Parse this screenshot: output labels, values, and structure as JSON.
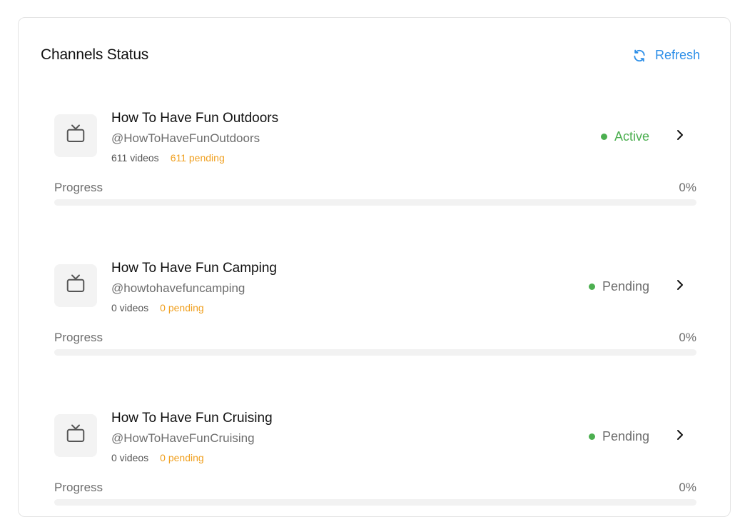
{
  "header": {
    "title": "Channels Status",
    "refresh_label": "Refresh"
  },
  "colors": {
    "accent": "#2d8fe8",
    "active": "#4caf50",
    "pending_text": "#f0a020"
  },
  "channels": [
    {
      "name": "How To Have Fun Outdoors",
      "handle": "@HowToHaveFunOutdoors",
      "videos": "611 videos",
      "pending": "611 pending",
      "status": "Active",
      "progress_label": "Progress",
      "progress_text": "0%",
      "progress_value": 0
    },
    {
      "name": "How To Have Fun Camping",
      "handle": "@howtohavefuncamping",
      "videos": "0 videos",
      "pending": "0 pending",
      "status": "Pending",
      "progress_label": "Progress",
      "progress_text": "0%",
      "progress_value": 0
    },
    {
      "name": "How To Have Fun Cruising",
      "handle": "@HowToHaveFunCruising",
      "videos": "0 videos",
      "pending": "0 pending",
      "status": "Pending",
      "progress_label": "Progress",
      "progress_text": "0%",
      "progress_value": 0
    }
  ],
  "icons": {
    "channel": "tv-icon",
    "refresh": "refresh-icon",
    "open": "chevron-right-icon"
  }
}
